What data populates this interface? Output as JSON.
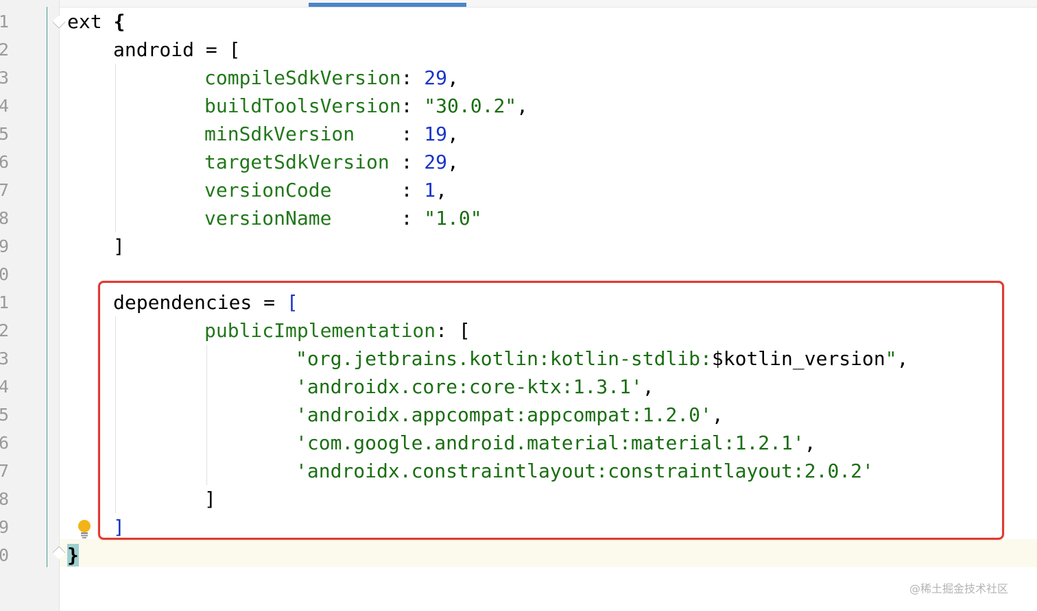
{
  "editor": {
    "line_numbers": [
      "1",
      "2",
      "3",
      "4",
      "5",
      "6",
      "7",
      "8",
      "9",
      "0",
      "1",
      "2",
      "3",
      "4",
      "5",
      "6",
      "7",
      "8",
      "9",
      "0"
    ],
    "lines": {
      "l1": {
        "a": "ext ",
        "b": "{"
      },
      "l2": {
        "a": "android = ["
      },
      "l3": {
        "key": "compileSdkVersion",
        "sep": ": ",
        "val": "29",
        "end": ","
      },
      "l4": {
        "key": "buildToolsVersion",
        "sep": ": ",
        "val": "\"30.0.2\"",
        "end": ","
      },
      "l5": {
        "key": "minSdkVersion    ",
        "sep": ": ",
        "val": "19",
        "end": ","
      },
      "l6": {
        "key": "targetSdkVersion ",
        "sep": ": ",
        "val": "29",
        "end": ","
      },
      "l7": {
        "key": "versionCode      ",
        "sep": ": ",
        "val": "1",
        "end": ","
      },
      "l8": {
        "key": "versionName      ",
        "sep": ": ",
        "val": "\"1.0\"",
        "end": ""
      },
      "l9": {
        "a": "]"
      },
      "l11": {
        "a": "dependencies = ",
        "b": "["
      },
      "l12": {
        "key": "publicImplementation",
        "sep": ": ["
      },
      "l13": {
        "s1": "\"org.jetbrains.kotlin:kotlin-stdlib:",
        "s2": "$kotlin_version",
        "s3": "\"",
        "end": ","
      },
      "l14": {
        "str": "'androidx.core:core-ktx:1.3.1'",
        "end": ","
      },
      "l15": {
        "str": "'androidx.appcompat:appcompat:1.2.0'",
        "end": ","
      },
      "l16": {
        "str": "'com.google.android.material:material:1.2.1'",
        "end": ","
      },
      "l17": {
        "str": "'androidx.constraintlayout:constraintlayout:2.0.2'",
        "end": ""
      },
      "l18": {
        "a": "]"
      },
      "l19": {
        "a": "]"
      },
      "l20": {
        "a": "}"
      }
    }
  },
  "watermark": "@稀土掘金技术社区",
  "colors": {
    "highlight_box": "#e03a32",
    "key": "#22771a",
    "number": "#1a34c8",
    "string": "#1a6e12"
  },
  "icons": {
    "bulb": "lightbulb-icon",
    "fold": "fold-marker-icon"
  }
}
